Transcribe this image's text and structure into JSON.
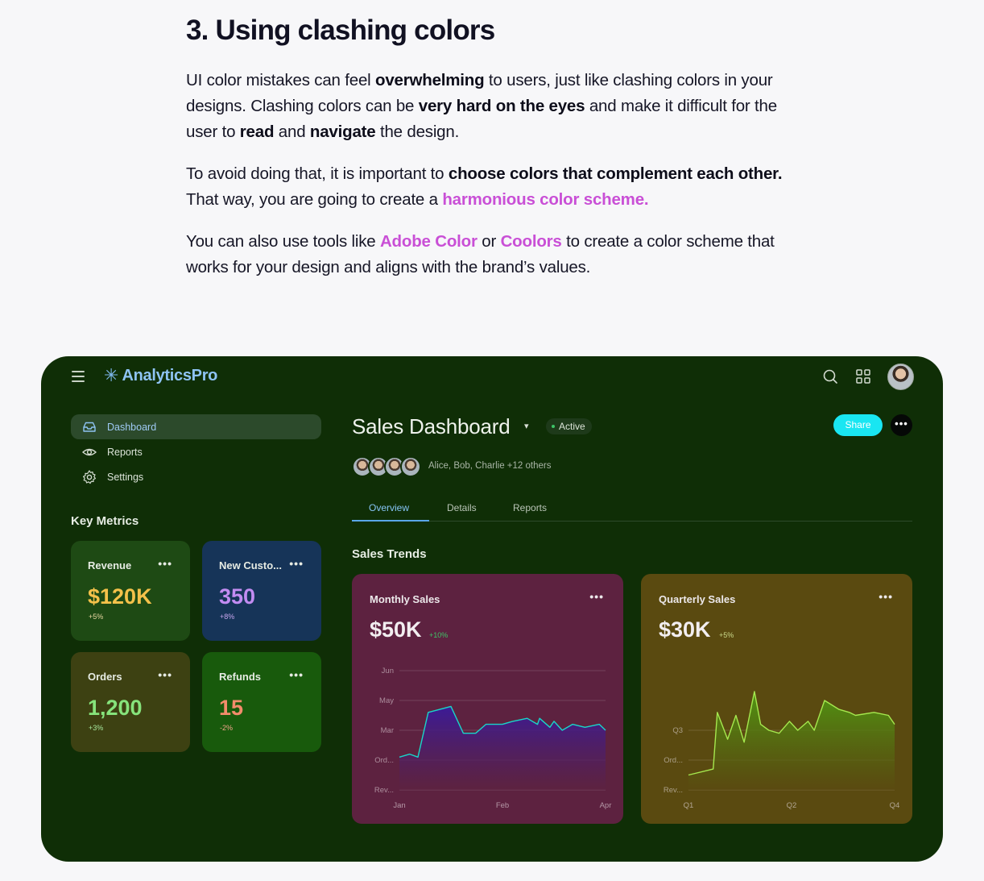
{
  "article": {
    "heading": "3. Using clashing colors",
    "p1": {
      "t1": "UI color mistakes can feel ",
      "b1": "overwhelming",
      "t2": " to users, just like clashing colors in your designs. Clashing colors can be ",
      "b2": "very hard on the eyes",
      "t3": " and make it difficult for the user to ",
      "b3": "read",
      "t4": " and ",
      "b4": "navigate",
      "t5": " the design."
    },
    "p2": {
      "t1": "To avoid doing that, it is important to ",
      "b1": "choose colors that complement each other.",
      "t2": " That way, you are going to create a ",
      "link": "harmonious color scheme."
    },
    "p3": {
      "t1": "You can also use tools like ",
      "link1": "Adobe Color",
      "t2": " or ",
      "link2": "Coolors",
      "t3": " to create a color scheme that works for your design and aligns with the brand’s values."
    }
  },
  "dashboard": {
    "brand": {
      "icon": "asterisk-icon",
      "name": "AnalyticsPro"
    },
    "top_icons": [
      "search-icon",
      "grid-icon",
      "user-avatar"
    ],
    "sidebar": {
      "items": [
        {
          "label": "Dashboard",
          "icon": "inbox-icon",
          "active": true
        },
        {
          "label": "Reports",
          "icon": "eye-icon",
          "active": false
        },
        {
          "label": "Settings",
          "icon": "gear-icon",
          "active": false
        }
      ],
      "key_metrics_title": "Key Metrics",
      "metrics": [
        {
          "label": "Revenue",
          "value": "$120K",
          "delta": "+5%",
          "bg": "#1e4a14",
          "value_color": "#f4c14a",
          "delta_color": "#e8d7a0"
        },
        {
          "label": "New Custo...",
          "value": "350",
          "delta": "+8%",
          "bg": "#163458",
          "value_color": "#c28cf2",
          "delta_color": "#c7a6ee"
        },
        {
          "label": "Orders",
          "value": "1,200",
          "delta": "+3%",
          "bg": "#3d4112",
          "value_color": "#86e37b",
          "delta_color": "#a6e79d"
        },
        {
          "label": "Refunds",
          "value": "15",
          "delta": "-2%",
          "bg": "#185a0c",
          "value_color": "#f28c6b",
          "delta_color": "#f2a48b"
        }
      ]
    },
    "main": {
      "title": "Sales Dashboard",
      "caret": "▾",
      "status": "Active",
      "share_label": "Share",
      "more_label": "•••",
      "collaborators": "Alice, Bob, Charlie +12 others",
      "tabs": [
        {
          "label": "Overview",
          "active": true
        },
        {
          "label": "Details",
          "active": false
        },
        {
          "label": "Reports",
          "active": false
        }
      ],
      "section_title": "Sales Trends"
    }
  },
  "chart_data": [
    {
      "type": "area",
      "title": "Monthly Sales",
      "headline_value": "$50K",
      "headline_delta": "+10%",
      "x_ticks": [
        "Jan",
        "Feb",
        "Apr"
      ],
      "y_ticks": [
        "Rev...",
        "Ord...",
        "Mar",
        "May",
        "Jun"
      ],
      "ylim": [
        0,
        4
      ],
      "series": [
        {
          "color": "#19d6c8",
          "x": [
            0,
            0.05,
            0.09,
            0.14,
            0.25,
            0.31,
            0.37,
            0.42,
            0.45,
            0.5,
            0.55,
            0.62,
            0.67,
            0.68,
            0.73,
            0.75,
            0.79,
            0.84,
            0.9,
            0.97,
            1.0
          ],
          "y": [
            1.1,
            1.2,
            1.1,
            2.6,
            2.8,
            1.9,
            1.9,
            2.2,
            2.2,
            2.2,
            2.3,
            2.4,
            2.2,
            2.4,
            2.1,
            2.3,
            2.0,
            2.2,
            2.1,
            2.2,
            2.0
          ]
        }
      ]
    },
    {
      "type": "area",
      "title": "Quarterly Sales",
      "headline_value": "$30K",
      "headline_delta": "+5%",
      "x_ticks": [
        "Q1",
        "Q2",
        "Q4"
      ],
      "y_ticks": [
        "Rev...",
        "Ord...",
        "Q3"
      ],
      "ylim": [
        0,
        4
      ],
      "series": [
        {
          "color": "#a5e84e",
          "x": [
            0,
            0.12,
            0.14,
            0.19,
            0.23,
            0.27,
            0.32,
            0.35,
            0.39,
            0.44,
            0.49,
            0.53,
            0.58,
            0.61,
            0.66,
            0.73,
            0.78,
            0.81,
            0.9,
            0.97,
            1.0
          ],
          "y": [
            0.5,
            0.7,
            2.6,
            1.7,
            2.5,
            1.6,
            3.3,
            2.2,
            2.0,
            1.9,
            2.3,
            2.0,
            2.3,
            2.0,
            3.0,
            2.7,
            2.6,
            2.5,
            2.6,
            2.5,
            2.2
          ]
        }
      ]
    }
  ]
}
